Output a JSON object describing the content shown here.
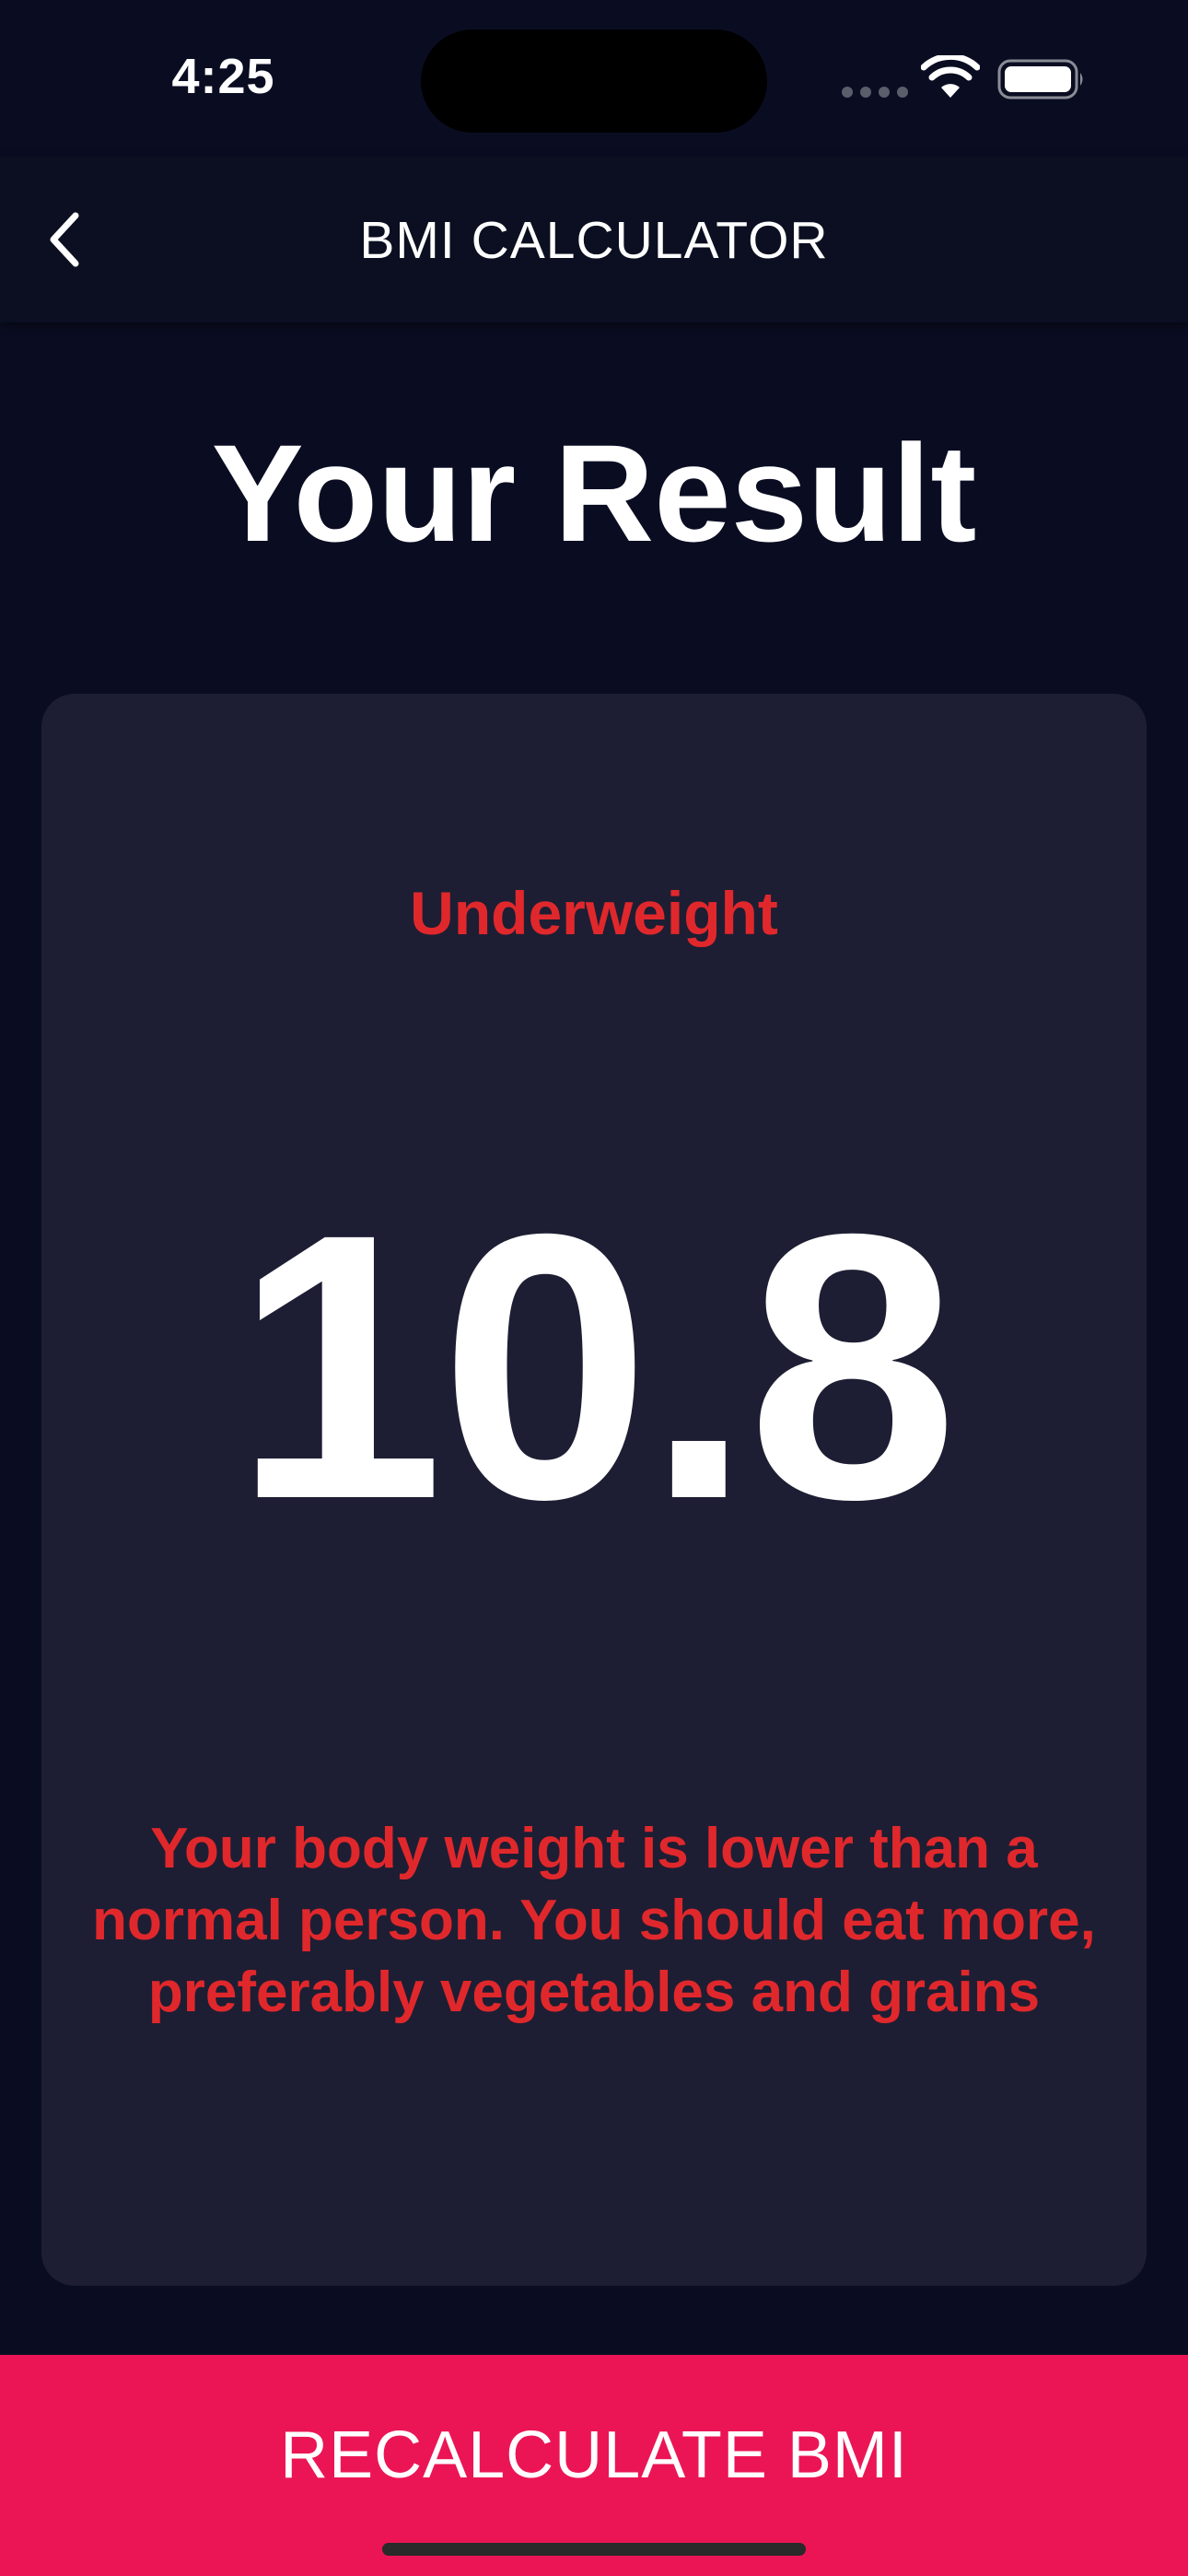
{
  "status_bar": {
    "time": "4:25",
    "icons": [
      "cellular-signal-icon",
      "wifi-icon",
      "battery-icon"
    ]
  },
  "app_bar": {
    "title": "BMI CALCULATOR",
    "back_icon": "chevron-left-icon"
  },
  "result": {
    "heading": "Your Result",
    "status": "Underweight",
    "bmi_value": "10.8",
    "message": "Your body weight is lower than a normal person. You should eat more, preferably vegetables and grains"
  },
  "action": {
    "recalculate_label": "RECALCULATE BMI"
  },
  "colors": {
    "background": "#0a0d22",
    "card": "#1d1e33",
    "accent_button": "#eb1555",
    "status_text": "#e0282c",
    "primary_text": "#ffffff"
  }
}
